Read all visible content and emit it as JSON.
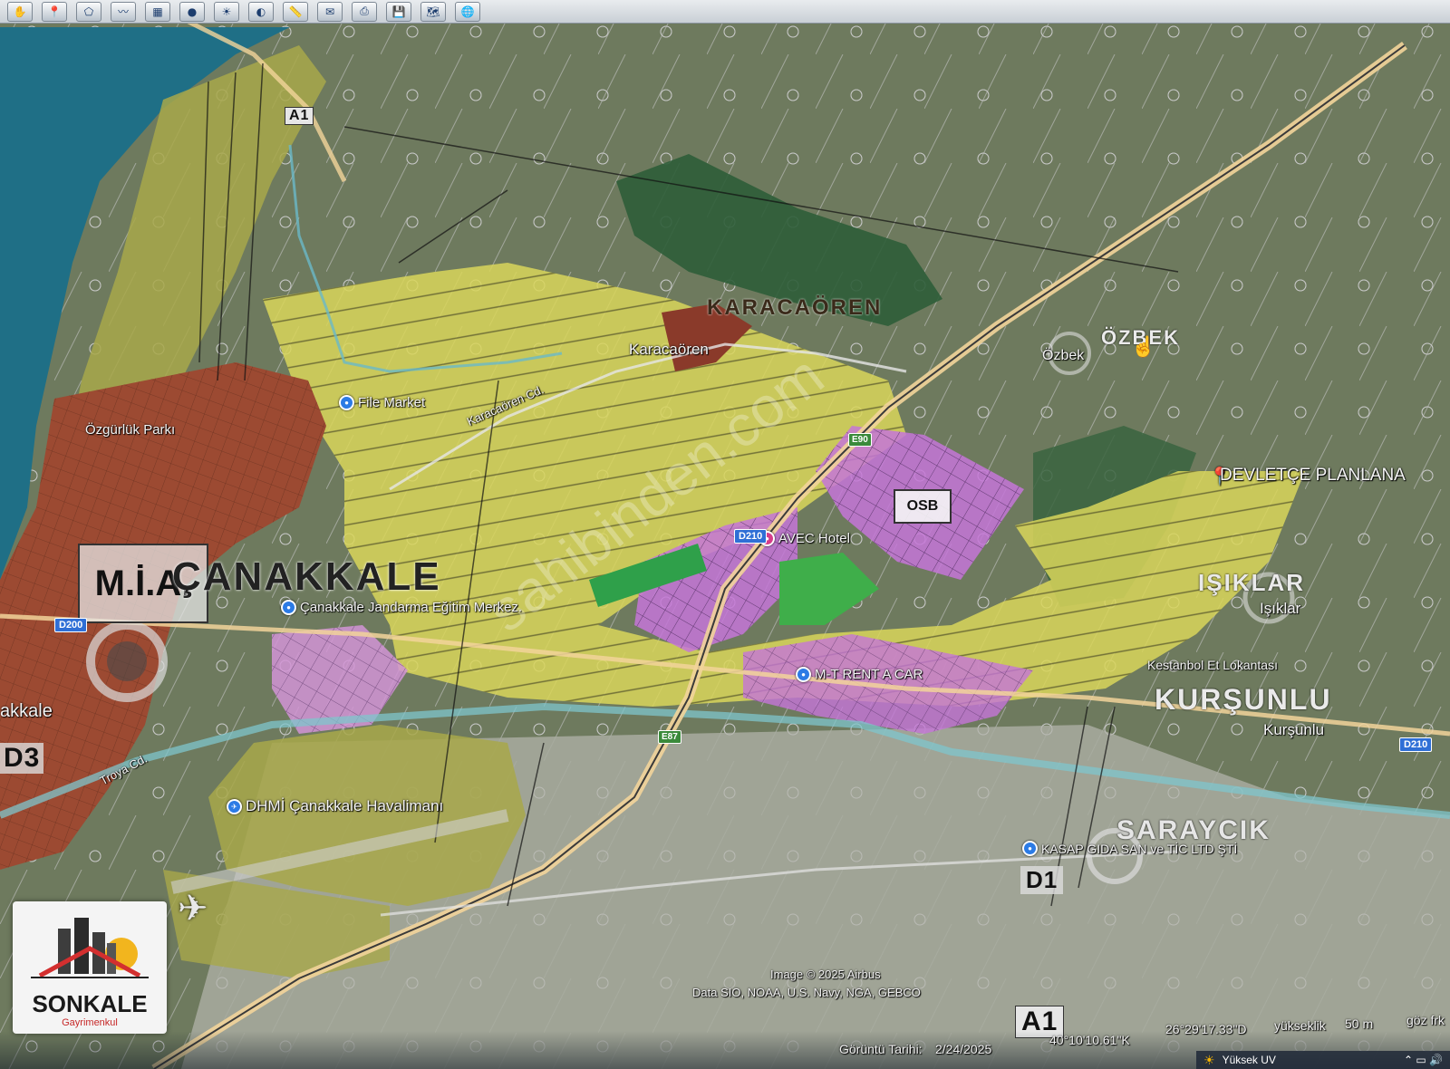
{
  "toolbar": {
    "icons": [
      "hand-icon",
      "pin-icon",
      "polygon-icon",
      "path-icon",
      "overlay-icon",
      "record-icon",
      "sun-icon",
      "planet-icon",
      "ruler-icon",
      "email-icon",
      "print-icon",
      "save-icon",
      "map-icon",
      "globe-icon"
    ]
  },
  "labels": {
    "karacaoren_big": "KARACAÖREN",
    "karacaoren": "Karacaören",
    "ozbek": "Özbek",
    "ozbek_big": "ÖZBEK",
    "ozgurluk": "Özgürlük Parkı",
    "file_market": "File Market",
    "karacaoren_cd": "Karacaören Cd.",
    "canakkale_big": "ÇANAKKALE",
    "mia": "M.İ.A.",
    "canakkale_partial": "akkale",
    "jandarma": "Çanakkale Jandarma Eğitim Merkez.",
    "avec": "AVEC Hotel",
    "osb": "OSB",
    "devletce": "DEVLETÇE PLANLANA",
    "isiklar_big": "IŞIKLAR",
    "isiklar": "Işıklar",
    "kestanbol": "Kestanbol Et Lokantası",
    "mt_rent": "M-T RENT A CAR",
    "kursunlu_big": "KURŞUNLU",
    "kursunlu": "Kurşunlu",
    "troya": "Troya Cd.",
    "dhmi": "DHMİ Çanakkale Havalimanı",
    "saraycik_big": "SARAYCIK",
    "kasap": "KASAP GIDA SAN ve TİC LTD ŞTİ",
    "d1": "D1",
    "a1_top": "A1",
    "a1_bottom": "A1",
    "d3": "D3",
    "watermark": "sahibinden.com"
  },
  "shields": {
    "d200": "D200",
    "d210_left": "D210",
    "d210_right": "D210",
    "e90": "E90",
    "e87": "E87"
  },
  "attribution": {
    "line1": "Image © 2025 Airbus",
    "line2": "Data SIO, NOAA, U.S. Navy, NGA, GEBCO"
  },
  "status": {
    "date_label": "Görüntü Tarihi:",
    "date": "2/24/2025",
    "lat": "40°10'10.61\"K",
    "lon": "26°29'17.33\"D",
    "elev_label": "yükseklik",
    "elev": "50 m",
    "eye_label": "göz frk"
  },
  "taskbar": {
    "weather": "Yüksek UV"
  },
  "logo": {
    "name": "SONKALE",
    "tagline": "Gayrimenkul"
  },
  "colors": {
    "sea": "#1f6f86",
    "urban": "#9c4a32",
    "residential": "#d9d65a",
    "olive": "#a8a84a",
    "industrial": "#c676d8",
    "forest": "#2e5d38",
    "park": "#3fae4a",
    "accent": "#e53935"
  }
}
